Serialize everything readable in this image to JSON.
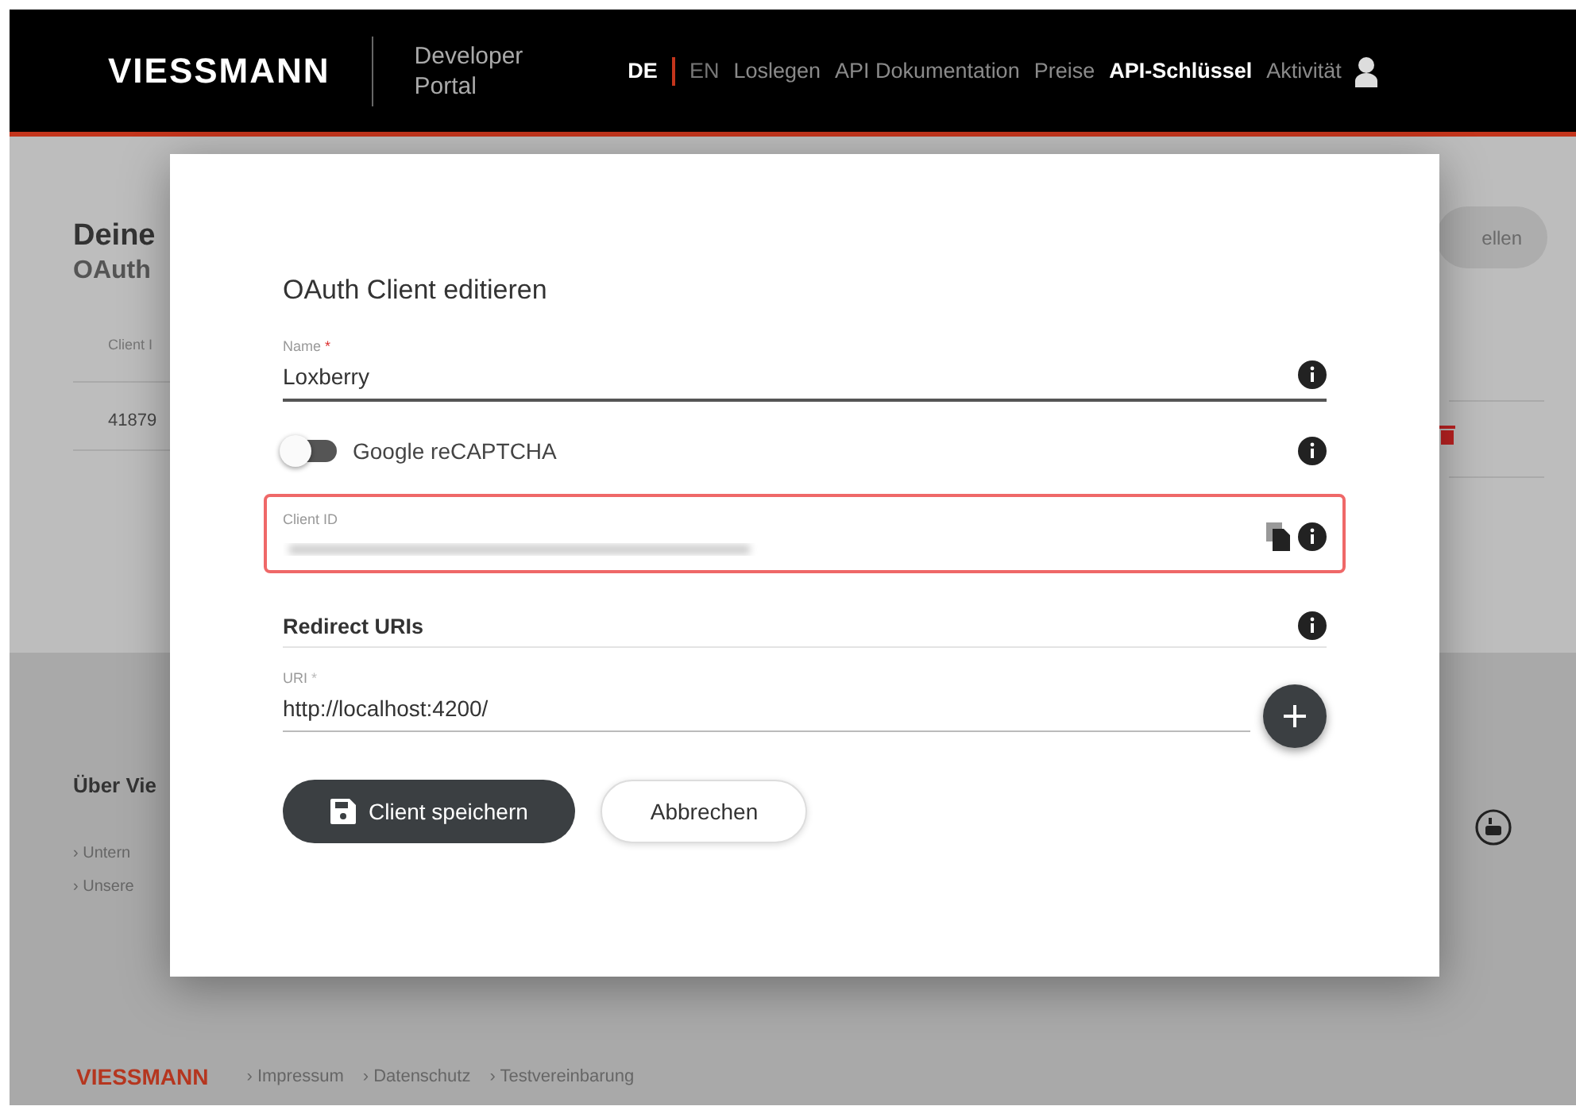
{
  "header": {
    "logo": "VIESSMANN",
    "portal_title": [
      "Developer",
      "Portal"
    ],
    "languages": [
      {
        "label": "DE",
        "selected": true
      },
      {
        "label": "EN",
        "selected": false
      }
    ],
    "nav": [
      {
        "label": "Loslegen",
        "selected": false
      },
      {
        "label": "API Dokumentation",
        "selected": false
      },
      {
        "label": "Preise",
        "selected": false
      },
      {
        "label": "API-Schlüssel",
        "selected": true
      },
      {
        "label": "Aktivität",
        "selected": false
      }
    ]
  },
  "background_page": {
    "heading": "Deine",
    "subheading": "OAuth",
    "create_button": "ellen",
    "column_1": "Client I",
    "row_1_cell": "41879",
    "footer_title": "Über Vie",
    "footer_links": [
      "› Untern",
      "› Unsere"
    ],
    "footer_logo": "VIESSMANN",
    "footer_bottom_links": [
      "› Impressum",
      "› Datenschutz",
      "› Testvereinbarung"
    ]
  },
  "dialog": {
    "title": "OAuth Client editieren",
    "name_field": {
      "label": "Name",
      "required_mark": "*",
      "value": "Loxberry"
    },
    "recaptcha": {
      "label": "Google reCAPTCHA",
      "on": false
    },
    "client_id": {
      "label": "Client ID",
      "error": true
    },
    "redirect_heading": "Redirect URIs",
    "uri_field": {
      "label": "URI",
      "required_mark": "*",
      "value": "http://localhost:4200/"
    },
    "buttons": [
      {
        "label": "Client speichern",
        "kind": "primary"
      },
      {
        "label": "Abbrechen",
        "kind": "secondary"
      }
    ]
  }
}
